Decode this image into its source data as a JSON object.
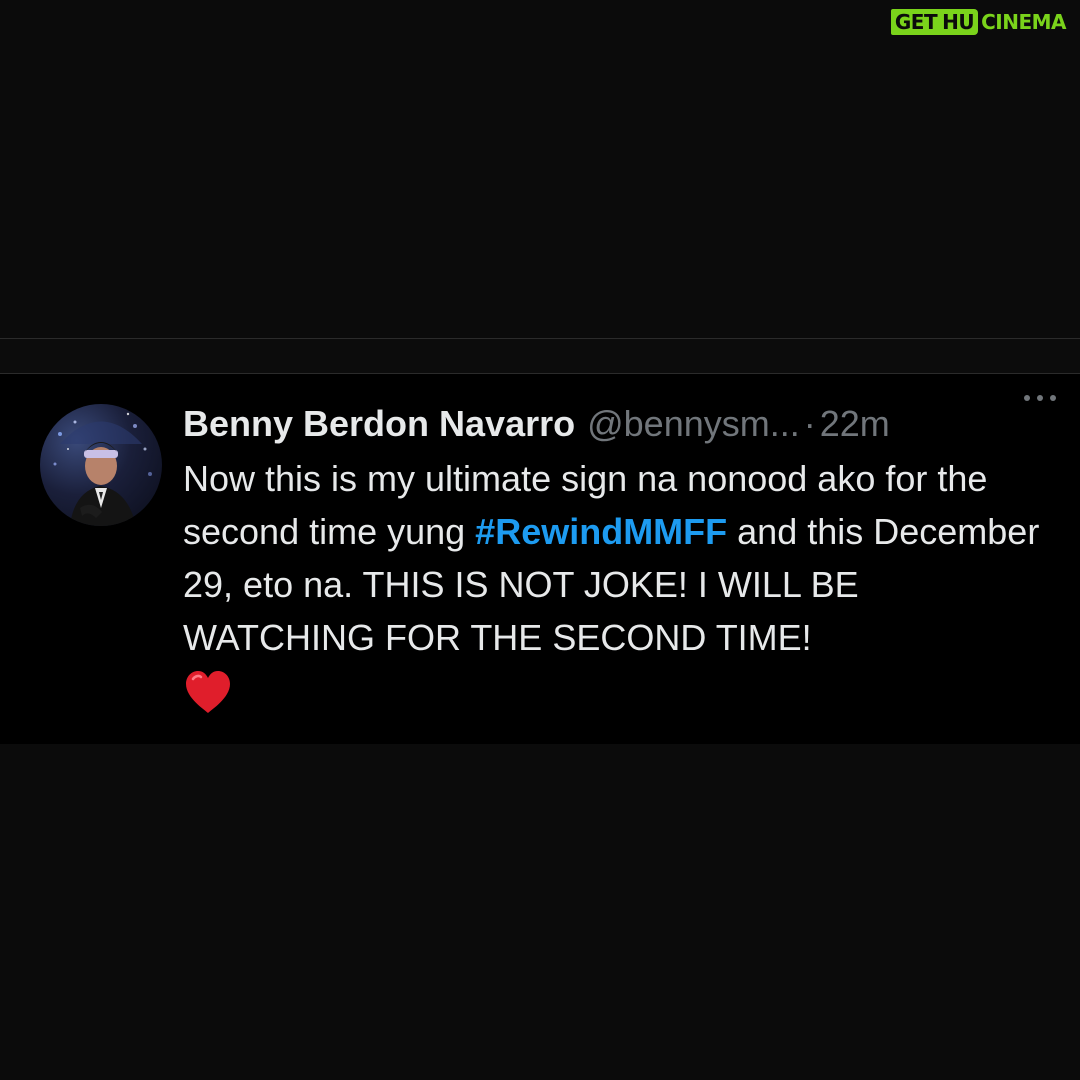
{
  "watermark": {
    "part1": "GET",
    "part2": "HU",
    "part3": "CINEMA",
    "accent": "#7ad31b"
  },
  "tweet": {
    "author_name": "Benny Berdon Navarro",
    "author_handle": "@bennysm...",
    "separator": "·",
    "timestamp": "22m",
    "text_before_hashtag": "Now this is my ultimate sign na nonood ako for the second time yung ",
    "hashtag": "#RewindMMFF",
    "text_after_hashtag": " and this December 29, eto na. THIS IS NOT JOKE! I WILL BE WATCHING FOR THE SECOND TIME!",
    "emoji_icon": "red-heart-icon",
    "more_icon": "more-horizontal-icon",
    "colors": {
      "text": "#e7e9ea",
      "muted": "#71767b",
      "link": "#1d9bf0",
      "heart": "#e01e2b"
    }
  }
}
